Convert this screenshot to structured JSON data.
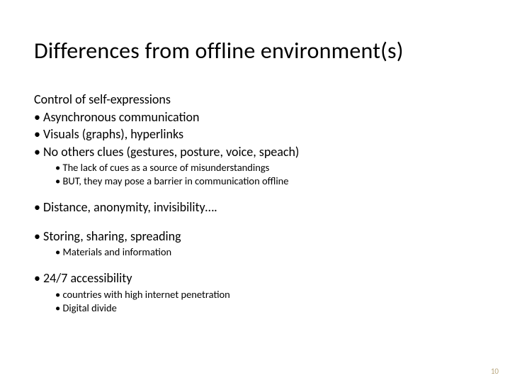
{
  "title": "Differences from offline environment(s)",
  "l1_0": "Control of self-expressions",
  "l1_1": "Asynchronous communication",
  "l1_2": "Visuals (graphs), hyperlinks",
  "l1_3": "No others clues (gestures, posture, voice, speach)",
  "l2_0": "The lack of cues as a source of misunderstandings",
  "l2_1": "BUT, they may pose a barrier in communication offline",
  "l1_4": "Distance, anonymity, invisibility….",
  "l1_5": "Storing, sharing, spreading",
  "l2_2": "Materials and information",
  "l1_6": "24/7 accessibility",
  "l2_3": "countries with high internet penetration",
  "l2_4": "Digital divide",
  "page_number": "10"
}
